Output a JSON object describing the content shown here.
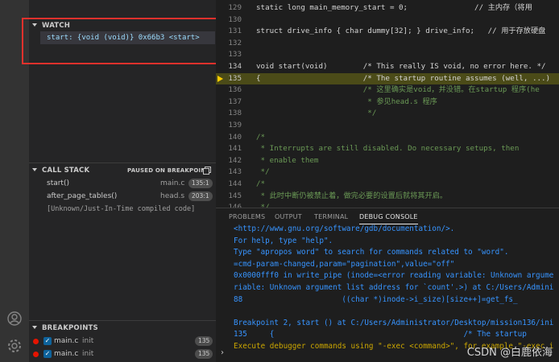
{
  "watch": {
    "header": "WATCH",
    "item": "start: {void (void)} 0x66b3 <start>"
  },
  "call_stack": {
    "header": "CALL STACK",
    "status": "PAUSED ON BREAKPOINT",
    "frames": [
      {
        "name": "start()",
        "file": "main.c",
        "pos": "135:1"
      },
      {
        "name": "after_page_tables()",
        "file": "head.s",
        "pos": "203:1"
      }
    ],
    "unknown": "[Unknown/Just-In-Time compiled code]"
  },
  "breakpoints": {
    "header": "BREAKPOINTS",
    "items": [
      {
        "file": "main.c",
        "label": "init",
        "line": "135"
      },
      {
        "file": "main.c",
        "label": "init",
        "line": "135"
      }
    ]
  },
  "editor": {
    "lines": [
      {
        "n": "129",
        "t": "static long main_memory_start = 0;               // 主内存（将用"
      },
      {
        "n": "130",
        "t": ""
      },
      {
        "n": "131",
        "t": "struct drive_info { char dummy[32]; } drive_info;   // 用于存放硬盘"
      },
      {
        "n": "132",
        "t": ""
      },
      {
        "n": "133",
        "t": ""
      },
      {
        "n": "134",
        "t": "void start(void)        /* This really IS void, no error here. */"
      },
      {
        "n": "135",
        "t": "{                       /* The startup routine assumes (well, ...)"
      },
      {
        "n": "136",
        "t": "                        /* 这里确实是void，并没错。在startup 程序(he"
      },
      {
        "n": "137",
        "t": "                         * 参见head.s 程序"
      },
      {
        "n": "138",
        "t": "                         */"
      },
      {
        "n": "139",
        "t": ""
      },
      {
        "n": "140",
        "t": "/*"
      },
      {
        "n": "141",
        "t": " * Interrupts are still disabled. Do necessary setups, then"
      },
      {
        "n": "142",
        "t": " * enable them"
      },
      {
        "n": "143",
        "t": " */"
      },
      {
        "n": "144",
        "t": "/*"
      },
      {
        "n": "145",
        "t": " * 此时中断仍被禁止着，做完必要的设置后就将其开启。"
      },
      {
        "n": "146",
        "t": " */"
      }
    ]
  },
  "panel": {
    "tabs": [
      "PROBLEMS",
      "OUTPUT",
      "TERMINAL",
      "DEBUG CONSOLE"
    ],
    "console": [
      "<http://www.gnu.org/software/gdb/documentation/>.",
      "For help, type \"help\".",
      "Type \"apropos word\" to search for commands related to \"word\".",
      "=cmd-param-changed,param=\"pagination\",value=\"off\"",
      "0x0000fff0 in write_pipe (inode=<error reading variable: Unknown argume",
      "riable: Unknown argument list address for `count'.>) at C:/Users/Admini",
      "88                      ((char *)inode->i_size)[size++]=get_fs_",
      "",
      "Breakpoint 2, start () at C:/Users/Administrator/Desktop/mission136/ini",
      "135     {                                          /* The startup",
      "Execute debugger commands using \"-exec <command>\", for example \"-exec i"
    ],
    "prompt": "›"
  },
  "watermark": "CSDN @白鹿依海",
  "colors": {
    "highlight": "#4b4b18",
    "breakpoint": "#e51400",
    "annotation_box": "#e3312c"
  }
}
